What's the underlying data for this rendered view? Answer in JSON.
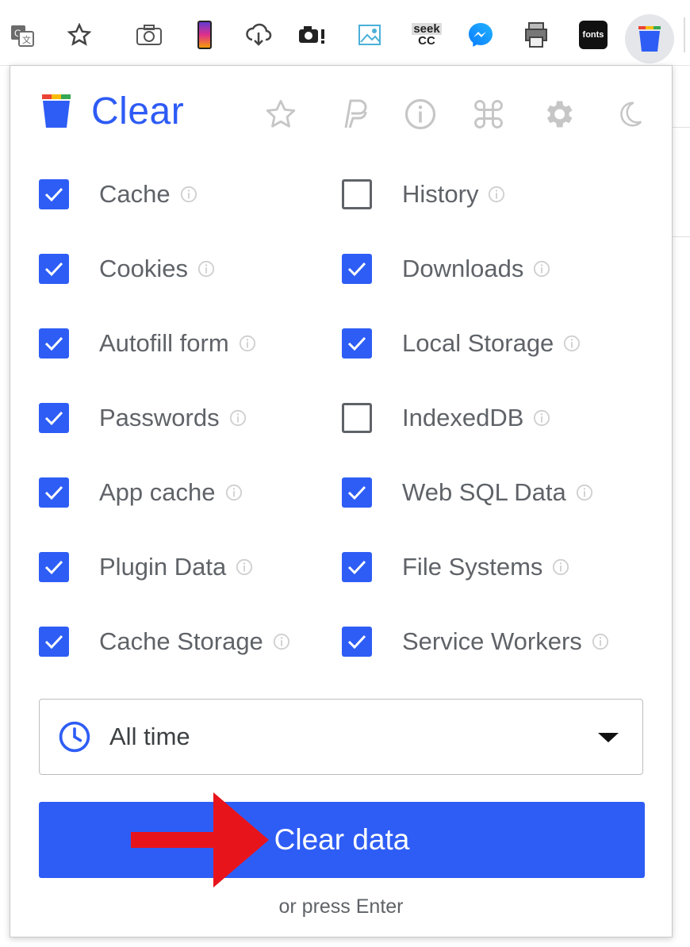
{
  "toolbar": {
    "icons": [
      "translate-icon",
      "bookmark-star-icon",
      "camera-icon",
      "phone-icon",
      "cloud-download-icon",
      "camera-extension-icon",
      "image-icon",
      "seek-cc-icon",
      "messenger-icon",
      "printer-icon",
      "fonts-icon",
      "clear-extension-icon"
    ],
    "seek_text_1": "seek",
    "seek_text_2": "CC",
    "fonts_text": "fonts"
  },
  "popup": {
    "title": "Clear",
    "header_icons": [
      "star-icon",
      "paypal-icon",
      "info-icon",
      "command-icon",
      "gear-icon",
      "moon-icon"
    ],
    "options_left": [
      {
        "label": "Cache",
        "checked": true
      },
      {
        "label": "Cookies",
        "checked": true
      },
      {
        "label": "Autofill form",
        "checked": true
      },
      {
        "label": "Passwords",
        "checked": true
      },
      {
        "label": "App cache",
        "checked": true
      },
      {
        "label": "Plugin Data",
        "checked": true
      },
      {
        "label": "Cache Storage",
        "checked": true
      }
    ],
    "options_right": [
      {
        "label": "History",
        "checked": false
      },
      {
        "label": "Downloads",
        "checked": true
      },
      {
        "label": "Local Storage",
        "checked": true
      },
      {
        "label": "IndexedDB",
        "checked": false
      },
      {
        "label": "Web SQL Data",
        "checked": true
      },
      {
        "label": "File Systems",
        "checked": true
      },
      {
        "label": "Service Workers",
        "checked": true
      }
    ],
    "time_range": "All time",
    "clear_button": "Clear data",
    "hint": "or press Enter"
  },
  "colors": {
    "accent": "#2e5df5",
    "text": "#5f6368",
    "arrow": "#e8141c"
  }
}
